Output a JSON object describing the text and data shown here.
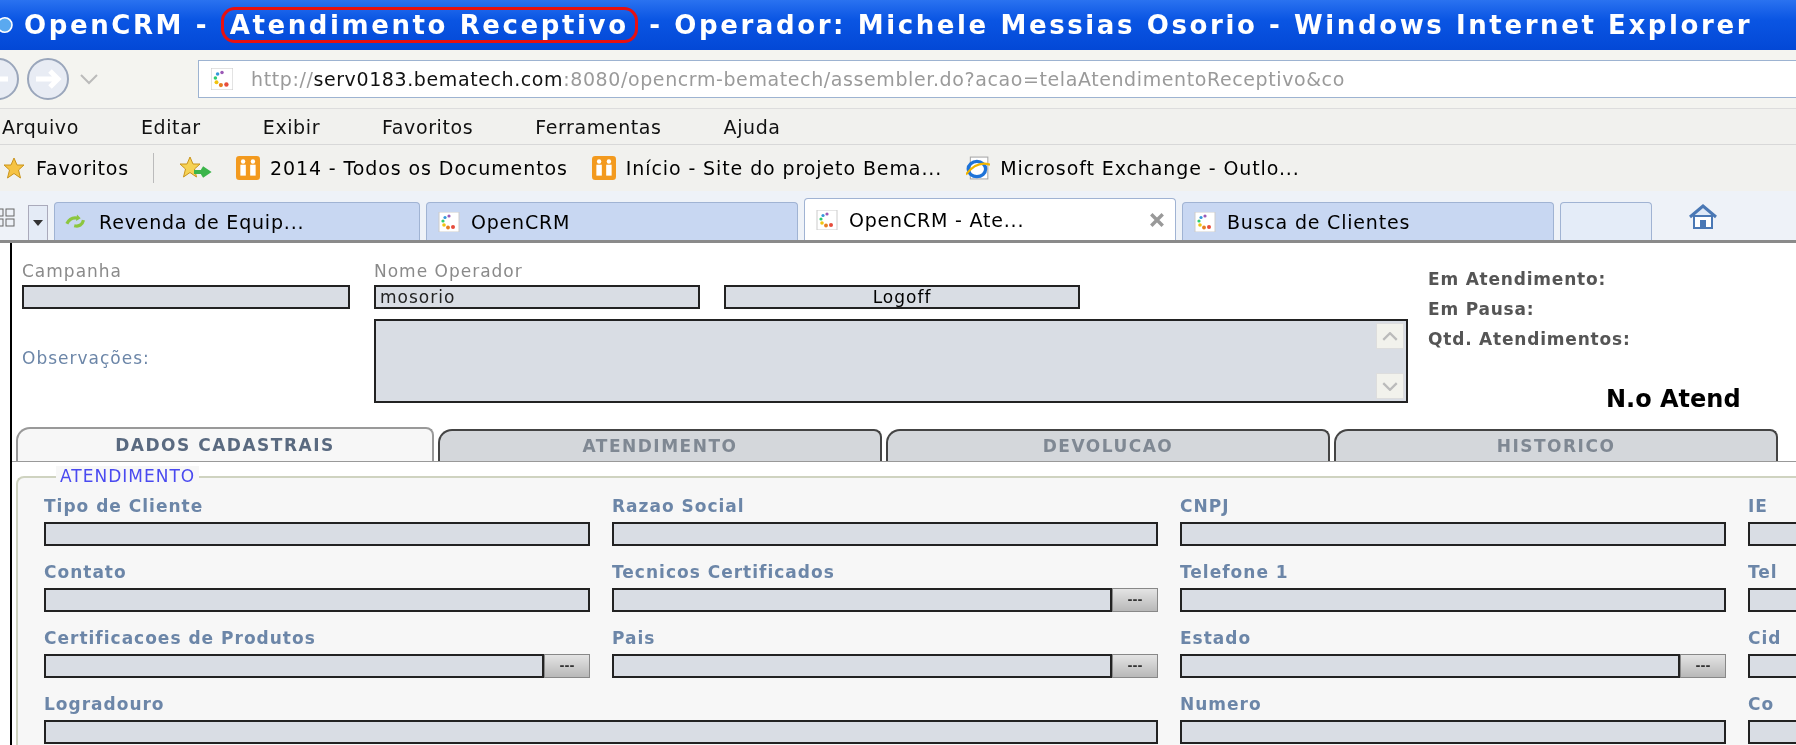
{
  "window": {
    "title_parts": [
      {
        "text": "OpenCRM -",
        "circled": false
      },
      {
        "text": "Atendimento Receptivo",
        "circled": true
      },
      {
        "text": "- Operador: Michele Messias Osorio - Windows Internet Explorer",
        "circled": false
      }
    ]
  },
  "address_bar": {
    "scheme": "http://",
    "host": "serv0183.bematech.com",
    "path": ":8080/opencrm-bematech/assembler.do?acao=telaAtendimentoReceptivo&co"
  },
  "menu": [
    "Arquivo",
    "Editar",
    "Exibir",
    "Favoritos",
    "Ferramentas",
    "Ajuda"
  ],
  "favorites_bar": {
    "label": "Favoritos",
    "links": [
      {
        "text": "2014 - Todos os Documentos",
        "kind": "sharepoint"
      },
      {
        "text": "Início - Site do projeto Bema...",
        "kind": "sharepoint"
      },
      {
        "text": "Microsoft Exchange - Outlo...",
        "kind": "ie"
      }
    ]
  },
  "browser_tabs": [
    {
      "title": "Revenda de Equip...",
      "kind": "recycle",
      "selected": false
    },
    {
      "title": "OpenCRM",
      "kind": "crm",
      "selected": false
    },
    {
      "title": "OpenCRM - Ate...",
      "kind": "crm",
      "selected": true
    },
    {
      "title": "Busca de Clientes",
      "kind": "crm",
      "selected": false
    },
    {
      "kind": "new",
      "selected": false
    }
  ],
  "header": {
    "campaign": {
      "label": "Campanha"
    },
    "operator": {
      "label": "Nome Operador",
      "value": "mosorio"
    },
    "logoff_button": "Logoff",
    "observations": {
      "label": "Observações:"
    },
    "stats": [
      "Em Atendimento:",
      "Em Pausa:",
      "Qtd. Atendimentos:"
    ],
    "ticket_label": "N.o Atend"
  },
  "form_tabs": [
    {
      "label": "DADOS CADASTRAIS",
      "selected": true
    },
    {
      "label": "ATENDIMENTO",
      "selected": false
    },
    {
      "label": "DEVOLUCAO",
      "selected": false
    },
    {
      "label": "HISTORICO",
      "selected": false
    }
  ],
  "section": {
    "legend": "ATENDIMENTO",
    "fields": [
      {
        "label": "Tipo de Cliente",
        "kind": "text"
      },
      {
        "label": "Razao Social",
        "kind": "text"
      },
      {
        "label": "CNPJ",
        "kind": "text"
      },
      {
        "label": "IE",
        "kind": "text"
      },
      {
        "label": "Contato",
        "kind": "text"
      },
      {
        "label": "Tecnicos Certificados",
        "kind": "lookup",
        "button": "---"
      },
      {
        "label": "Telefone 1",
        "kind": "text"
      },
      {
        "label": "Tel",
        "kind": "text"
      },
      {
        "label": "Certificacoes de Produtos",
        "kind": "lookup",
        "button": "---"
      },
      {
        "label": "Pais",
        "kind": "lookup",
        "button": "---"
      },
      {
        "label": "Estado",
        "kind": "lookup",
        "button": "---"
      },
      {
        "label": "Cid",
        "kind": "text"
      },
      {
        "label": "Logradouro",
        "kind": "wide"
      },
      {
        "label": "Numero",
        "kind": "text"
      },
      {
        "label": "Co",
        "kind": "text"
      }
    ]
  }
}
